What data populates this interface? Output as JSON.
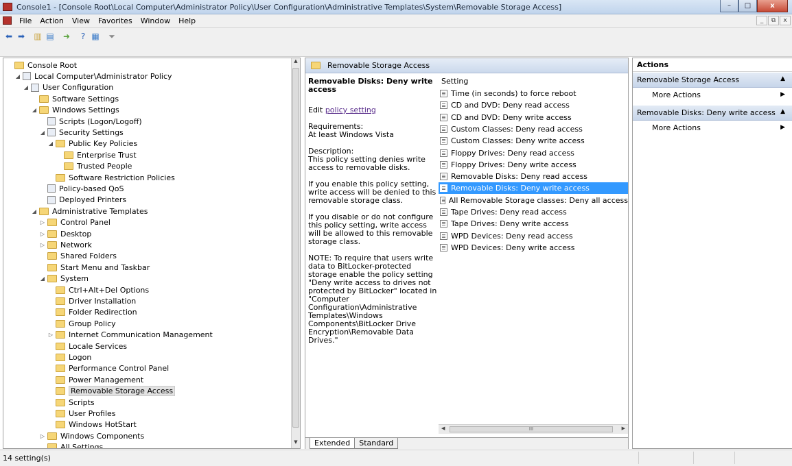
{
  "window": {
    "title": "Console1 - [Console Root\\Local Computer\\Administrator Policy\\User Configuration\\Administrative Templates\\System\\Removable Storage Access]",
    "buttons": {
      "minimize": "–",
      "maximize": "□",
      "close": "x"
    }
  },
  "menu": {
    "items": [
      "File",
      "Action",
      "View",
      "Favorites",
      "Window",
      "Help"
    ],
    "mdi": [
      "_",
      "⧉",
      "x"
    ]
  },
  "toolbar": {
    "icons": [
      "back-icon",
      "forward-icon",
      "up-folder-icon",
      "show-hide-tree-icon",
      "export-icon",
      "help-icon",
      "show-hide-action-icon",
      "filter-icon"
    ]
  },
  "tree": {
    "nodes": [
      {
        "label": "Console Root",
        "indent": 0,
        "arrow": "",
        "icon": "folder"
      },
      {
        "label": "Local Computer\\Administrator Policy",
        "indent": 1,
        "arrow": "◢",
        "icon": "policy"
      },
      {
        "label": "User Configuration",
        "indent": 2,
        "arrow": "◢",
        "icon": "users"
      },
      {
        "label": "Software Settings",
        "indent": 3,
        "arrow": "",
        "icon": "folder"
      },
      {
        "label": "Windows Settings",
        "indent": 3,
        "arrow": "◢",
        "icon": "folder"
      },
      {
        "label": "Scripts (Logon/Logoff)",
        "indent": 4,
        "arrow": "",
        "icon": "script"
      },
      {
        "label": "Security Settings",
        "indent": 4,
        "arrow": "◢",
        "icon": "security"
      },
      {
        "label": "Public Key Policies",
        "indent": 5,
        "arrow": "◢",
        "icon": "folder"
      },
      {
        "label": "Enterprise Trust",
        "indent": 6,
        "arrow": "",
        "icon": "folder"
      },
      {
        "label": "Trusted People",
        "indent": 6,
        "arrow": "",
        "icon": "folder"
      },
      {
        "label": "Software Restriction Policies",
        "indent": 5,
        "arrow": "",
        "icon": "folder"
      },
      {
        "label": "Policy-based QoS",
        "indent": 4,
        "arrow": "",
        "icon": "chart"
      },
      {
        "label": "Deployed Printers",
        "indent": 4,
        "arrow": "",
        "icon": "printer"
      },
      {
        "label": "Administrative Templates",
        "indent": 3,
        "arrow": "◢",
        "icon": "folder"
      },
      {
        "label": "Control Panel",
        "indent": 4,
        "arrow": "▷",
        "icon": "folder"
      },
      {
        "label": "Desktop",
        "indent": 4,
        "arrow": "▷",
        "icon": "folder"
      },
      {
        "label": "Network",
        "indent": 4,
        "arrow": "▷",
        "icon": "folder"
      },
      {
        "label": "Shared Folders",
        "indent": 4,
        "arrow": "",
        "icon": "folder"
      },
      {
        "label": "Start Menu and Taskbar",
        "indent": 4,
        "arrow": "",
        "icon": "folder"
      },
      {
        "label": "System",
        "indent": 4,
        "arrow": "◢",
        "icon": "folder"
      },
      {
        "label": "Ctrl+Alt+Del Options",
        "indent": 5,
        "arrow": "",
        "icon": "folder"
      },
      {
        "label": "Driver Installation",
        "indent": 5,
        "arrow": "",
        "icon": "folder"
      },
      {
        "label": "Folder Redirection",
        "indent": 5,
        "arrow": "",
        "icon": "folder"
      },
      {
        "label": "Group Policy",
        "indent": 5,
        "arrow": "",
        "icon": "folder"
      },
      {
        "label": "Internet Communication Management",
        "indent": 5,
        "arrow": "▷",
        "icon": "folder"
      },
      {
        "label": "Locale Services",
        "indent": 5,
        "arrow": "",
        "icon": "folder"
      },
      {
        "label": "Logon",
        "indent": 5,
        "arrow": "",
        "icon": "folder"
      },
      {
        "label": "Performance Control Panel",
        "indent": 5,
        "arrow": "",
        "icon": "folder"
      },
      {
        "label": "Power Management",
        "indent": 5,
        "arrow": "",
        "icon": "folder"
      },
      {
        "label": "Removable Storage Access",
        "indent": 5,
        "arrow": "",
        "icon": "folder",
        "selected": true
      },
      {
        "label": "Scripts",
        "indent": 5,
        "arrow": "",
        "icon": "folder"
      },
      {
        "label": "User Profiles",
        "indent": 5,
        "arrow": "",
        "icon": "folder"
      },
      {
        "label": "Windows HotStart",
        "indent": 5,
        "arrow": "",
        "icon": "folder"
      },
      {
        "label": "Windows Components",
        "indent": 4,
        "arrow": "▷",
        "icon": "folder"
      },
      {
        "label": "All Settings",
        "indent": 4,
        "arrow": "",
        "icon": "folder"
      }
    ]
  },
  "middle": {
    "header": "Removable Storage Access",
    "selected_title": "Removable Disks: Deny write access",
    "edit_prefix": "Edit ",
    "edit_link": "policy setting",
    "requirements_label": "Requirements:",
    "requirements_value": "At least Windows Vista",
    "description_label": "Description:",
    "description_text": "This policy setting denies write access to removable disks.",
    "enable_text": "If you enable this policy setting, write access will be denied to this removable storage class.",
    "disable_text": "If you disable or do not configure this policy setting, write access will be allowed to this removable storage class.",
    "note_text": "NOTE: To require that users write data to BitLocker-protected storage enable the policy setting \"Deny write access to drives not protected by BitLocker\" located in \"Computer Configuration\\Administrative Templates\\Windows Components\\BitLocker Drive Encryption\\Removable Data Drives.\"",
    "column_header": "Setting",
    "settings": [
      "Time (in seconds) to force reboot",
      "CD and DVD: Deny read access",
      "CD and DVD: Deny write access",
      "Custom Classes: Deny read access",
      "Custom Classes: Deny write access",
      "Floppy Drives: Deny read access",
      "Floppy Drives: Deny write access",
      "Removable Disks: Deny read access",
      "Removable Disks: Deny write access",
      "All Removable Storage classes: Deny all access",
      "Tape Drives: Deny read access",
      "Tape Drives: Deny write access",
      "WPD Devices: Deny read access",
      "WPD Devices: Deny write access"
    ],
    "selected_setting_index": 8,
    "hscroll_grip": "III",
    "tabs": [
      "Extended",
      "Standard"
    ]
  },
  "actions": {
    "header": "Actions",
    "sections": [
      {
        "title": "Removable Storage Access",
        "item": "More Actions"
      },
      {
        "title": "Removable Disks: Deny write access",
        "item": "More Actions"
      }
    ]
  },
  "status": {
    "text": "14 setting(s)"
  }
}
